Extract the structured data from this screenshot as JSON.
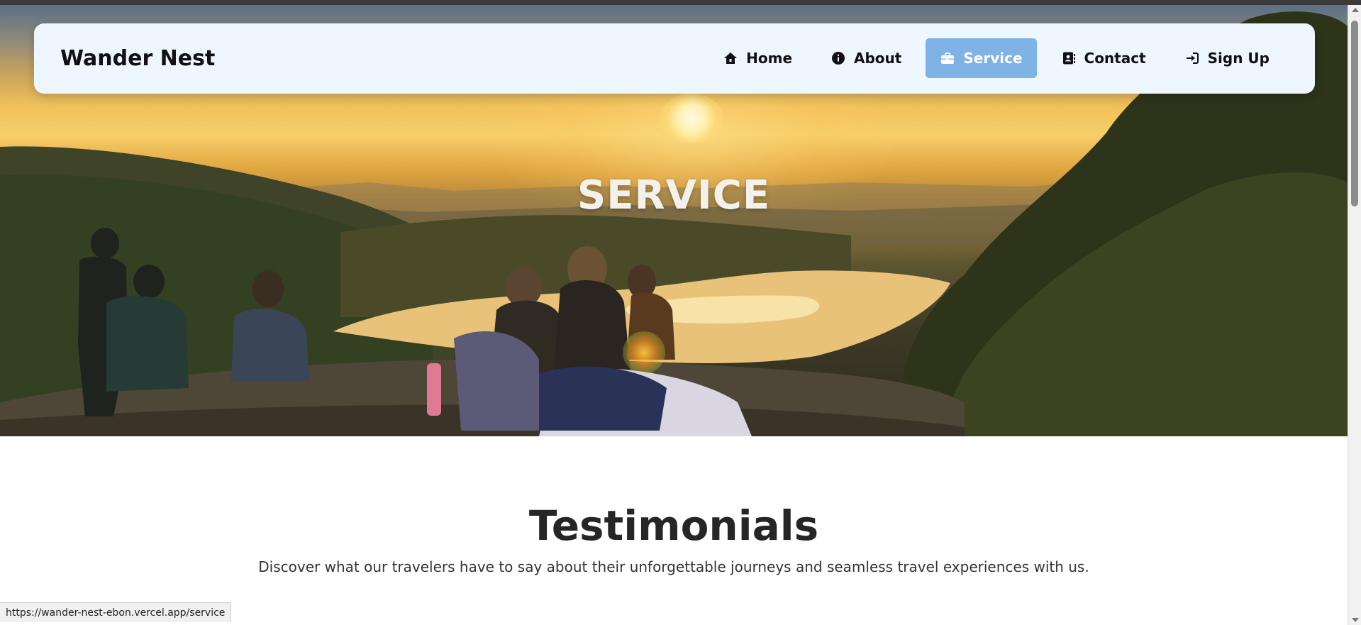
{
  "brand": "Wander Nest",
  "nav": {
    "items": [
      {
        "label": "Home",
        "icon": "home-icon",
        "active": false
      },
      {
        "label": "About",
        "icon": "info-icon",
        "active": false
      },
      {
        "label": "Service",
        "icon": "briefcase-icon",
        "active": true
      },
      {
        "label": "Contact",
        "icon": "contact-book-icon",
        "active": false
      },
      {
        "label": "Sign Up",
        "icon": "sign-in-icon",
        "active": false
      }
    ]
  },
  "hero": {
    "title": "SERVICE",
    "image_alt_icon": "sunset-landscape-image"
  },
  "testimonials": {
    "title": "Testimonials",
    "subtitle": "Discover what our travelers have to say about their unforgettable journeys and seamless travel experiences with us."
  },
  "status": {
    "url": "https://wander-nest-ebon.vercel.app/service"
  },
  "colors": {
    "nav_bg": "#eef6ff",
    "active_bg": "#7fb2e5",
    "heading": "#262626"
  }
}
